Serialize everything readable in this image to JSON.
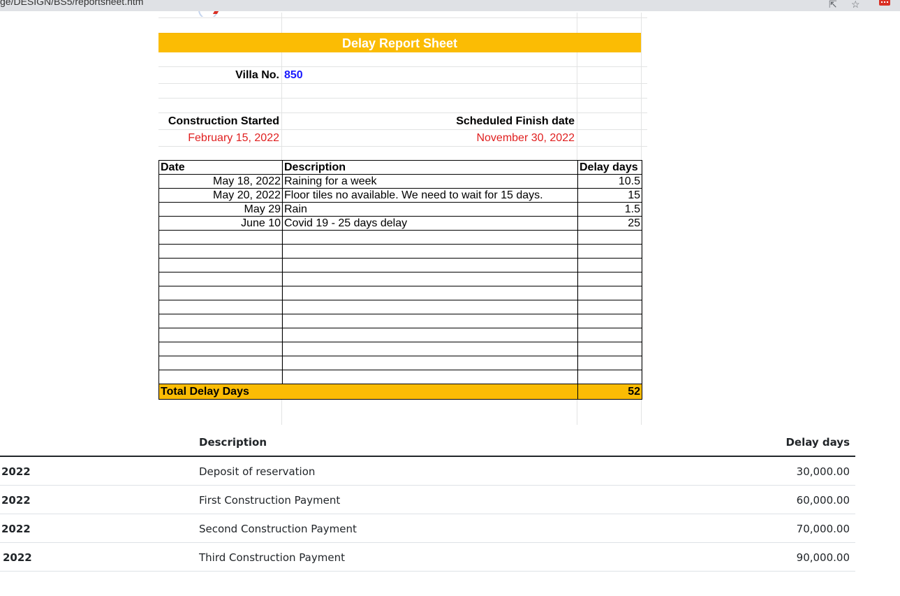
{
  "browser": {
    "url_fragment": "ge/DESIGN/BS5/reportsheet.htm",
    "share_icon": "share-icon",
    "bookmark_icon": "star-icon",
    "extension_icon": "extension-icon"
  },
  "sheet": {
    "title": "Delay Report Sheet",
    "villa_label": "Villa No.",
    "villa_value": "850",
    "construction_started_label": "Construction Started",
    "construction_started_value": "February 15, 2022",
    "scheduled_finish_label": "Scheduled Finish date",
    "scheduled_finish_value": "November 30, 2022",
    "columns": [
      "Date",
      "Description",
      "Delay days"
    ],
    "rows": [
      {
        "date": "May 18, 2022",
        "description": "Raining for a week",
        "days": "10.5"
      },
      {
        "date": "May 20, 2022",
        "description": "Floor tiles no available. We need to wait for 15 days.",
        "days": "15"
      },
      {
        "date": "May 29",
        "description": "Rain",
        "days": "1.5"
      },
      {
        "date": "June 10",
        "description": "Covid 19 - 25 days delay",
        "days": "25"
      }
    ],
    "empty_rows": 11,
    "total_label": "Total Delay Days",
    "total_value": "52",
    "colors": {
      "accent": "#fbbc04",
      "date_text": "#e01f1f",
      "villa_text": "#1a1aff"
    }
  },
  "payments": {
    "columns": {
      "description": "Description",
      "amount": "Delay days"
    },
    "rows": [
      {
        "date": "2022",
        "description": "Deposit of reservation",
        "amount": "30,000.00"
      },
      {
        "date": "2022",
        "description": "First Construction Payment",
        "amount": "60,000.00"
      },
      {
        "date": "2022",
        "description": "Second Construction Payment",
        "amount": "70,000.00"
      },
      {
        "date": "2022",
        "description": "Third Construction Payment",
        "amount": "90,000.00"
      }
    ]
  }
}
